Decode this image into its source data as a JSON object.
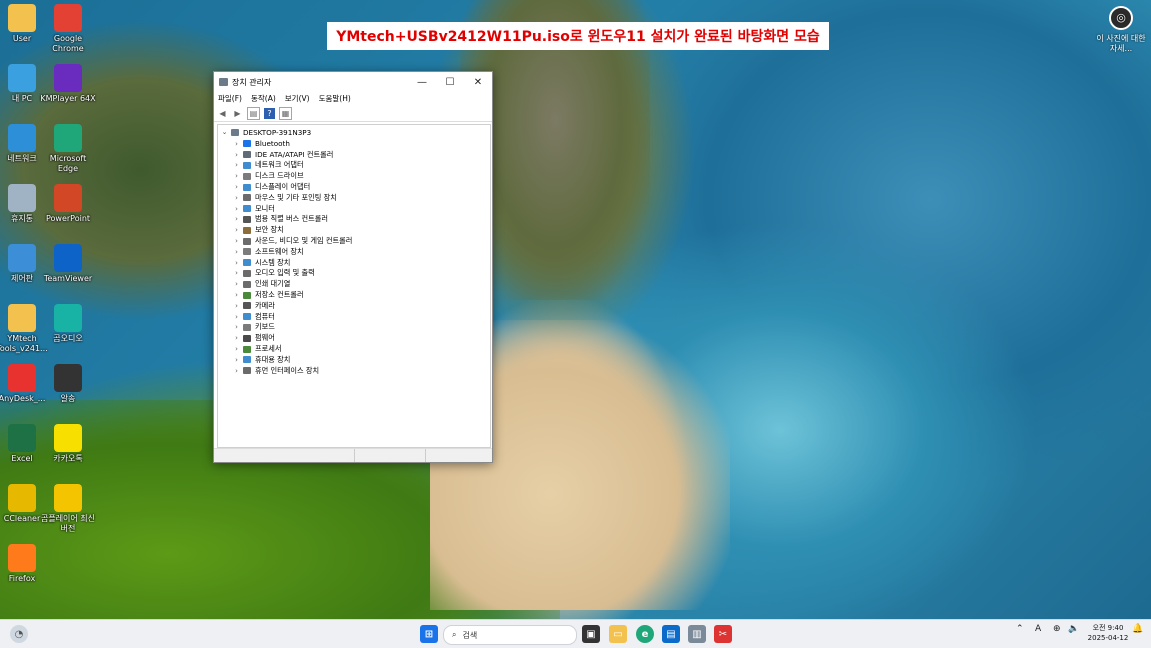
{
  "banner": {
    "text": "YMtech+USBv2412W11Pu.iso로 윈도우11 설치가 완료된 바탕화면 모습"
  },
  "desktop_icons": [
    {
      "label": "User",
      "icon": "folder-icon",
      "color": "#f2c14e"
    },
    {
      "label": "Google Chrome",
      "icon": "chrome-icon",
      "color": "#e34133"
    },
    {
      "label": "내 PC",
      "icon": "monitor-icon",
      "color": "#3aa0e0"
    },
    {
      "label": "KMPlayer 64X",
      "icon": "kmplayer-icon",
      "color": "#6a2bbf"
    },
    {
      "label": "네트워크",
      "icon": "network-icon",
      "color": "#2d8fd8"
    },
    {
      "label": "Microsoft Edge",
      "icon": "edge-icon",
      "color": "#1fa77a"
    },
    {
      "label": "휴지통",
      "icon": "recycle-bin-icon",
      "color": "#9fb3c4"
    },
    {
      "label": "PowerPoint",
      "icon": "powerpoint-icon",
      "color": "#d24726"
    },
    {
      "label": "제어판",
      "icon": "control-panel-icon",
      "color": "#3c8fd6"
    },
    {
      "label": "TeamViewer",
      "icon": "teamviewer-icon",
      "color": "#0e63c9"
    },
    {
      "label": "YMtech Tools_v241...",
      "icon": "folder-icon",
      "color": "#f2c14e"
    },
    {
      "label": "곰오디오",
      "icon": "gomaudio-icon",
      "color": "#19b3a5"
    },
    {
      "label": "AnyDesk_...",
      "icon": "anydesk-icon",
      "color": "#e8322f"
    },
    {
      "label": "알송",
      "icon": "alsong-icon",
      "color": "#333333"
    },
    {
      "label": "Excel",
      "icon": "excel-icon",
      "color": "#1e7145"
    },
    {
      "label": "카카오톡",
      "icon": "kakaotalk-icon",
      "color": "#f7e000"
    },
    {
      "label": "CCleaner",
      "icon": "ccleaner-icon",
      "color": "#e6b800"
    },
    {
      "label": "곰플레이어 최신버전",
      "icon": "gomplayer-icon",
      "color": "#f5c400"
    },
    {
      "label": "Firefox",
      "icon": "firefox-icon",
      "color": "#ff7a1a"
    }
  ],
  "top_right": {
    "label": "이 사진에 대한 자세..."
  },
  "window": {
    "title": "장치 관리자",
    "menus": [
      "파일(F)",
      "동작(A)",
      "보기(V)",
      "도움말(H)"
    ],
    "root": "DESKTOP-391N3P3",
    "items": [
      {
        "label": "Bluetooth",
        "color": "#1a73e8"
      },
      {
        "label": "IDE ATA/ATAPI 컨트롤러",
        "color": "#5f6b78"
      },
      {
        "label": "네트워크 어댑터",
        "color": "#3f8ccf"
      },
      {
        "label": "디스크 드라이브",
        "color": "#7b7b7b"
      },
      {
        "label": "디스플레이 어댑터",
        "color": "#3f8ccf"
      },
      {
        "label": "마우스 및 기타 포인팅 장치",
        "color": "#6b6b6b"
      },
      {
        "label": "모니터",
        "color": "#3f8ccf"
      },
      {
        "label": "범용 직렬 버스 컨트롤러",
        "color": "#555555"
      },
      {
        "label": "보안 장치",
        "color": "#8a6d3b"
      },
      {
        "label": "사운드, 비디오 및 게임 컨트롤러",
        "color": "#6b6b6b"
      },
      {
        "label": "소프트웨어 장치",
        "color": "#7b7b7b"
      },
      {
        "label": "시스템 장치",
        "color": "#3f8ccf"
      },
      {
        "label": "오디오 입력 및 출력",
        "color": "#6b6b6b"
      },
      {
        "label": "인쇄 대기열",
        "color": "#6b6b6b"
      },
      {
        "label": "저장소 컨트롤러",
        "color": "#4a8a3a"
      },
      {
        "label": "카메라",
        "color": "#555555"
      },
      {
        "label": "컴퓨터",
        "color": "#3f8ccf"
      },
      {
        "label": "키보드",
        "color": "#7b7b7b"
      },
      {
        "label": "펌웨어",
        "color": "#4a4a4a"
      },
      {
        "label": "프로세서",
        "color": "#4a8a3a"
      },
      {
        "label": "휴대용 장치",
        "color": "#3f8ccf"
      },
      {
        "label": "휴먼 인터페이스 장치",
        "color": "#6b6b6b"
      }
    ]
  },
  "taskbar": {
    "search_placeholder": "검색",
    "clock_time": "오전 9:40",
    "clock_date": "2025-04-12",
    "lang": "A"
  }
}
